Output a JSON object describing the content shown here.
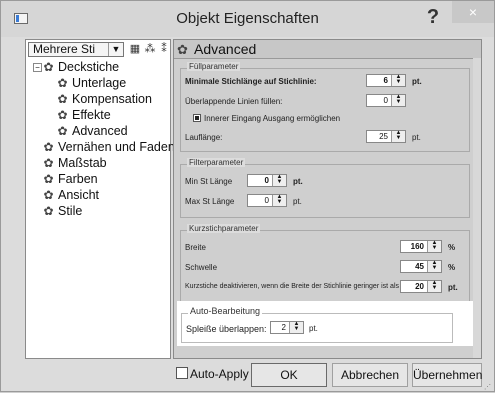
{
  "window": {
    "title": "Objekt Eigenschaften",
    "help": "?",
    "close": "×"
  },
  "left": {
    "combo": "Mehrere Sti",
    "tree": [
      {
        "label": "Deckstiche"
      },
      {
        "label": "Unterlage"
      },
      {
        "label": "Kompensation"
      },
      {
        "label": "Effekte"
      },
      {
        "label": "Advanced"
      },
      {
        "label": "Vernähen und Fadens"
      },
      {
        "label": "Maßstab"
      },
      {
        "label": "Farben"
      },
      {
        "label": "Ansicht"
      },
      {
        "label": "Stile"
      }
    ]
  },
  "right": {
    "header": "Advanced",
    "fuell": {
      "title": "Füllparameter",
      "min_label": "Minimale Stichlänge auf Stichlinie:",
      "min_value": "6",
      "unit_pt": "pt.",
      "ueber_label": "Überlappende Linien füllen:",
      "ueber_value": "0",
      "innerer_label": "Innerer Eingang Ausgang ermöglichen",
      "lauf_label": "Lauflänge:",
      "lauf_value": "25"
    },
    "filter": {
      "title": "Filterparameter",
      "min_label": "Min St Länge",
      "min_value": "0",
      "max_label": "Max St Länge",
      "max_value": "0"
    },
    "kurz": {
      "title": "Kurzstichparameter",
      "breite_label": "Breite",
      "breite_value": "160",
      "schwelle_label": "Schwelle",
      "schwelle_value": "45",
      "unit_pct": "%",
      "kdeak_label": "Kurzstiche deaktivieren, wenn die Breite der Stichlinie geringer ist als",
      "kdeak_value": "20"
    },
    "auto": {
      "title": "Auto-Bearbeitung",
      "spl_label": "Spleiße überlappen:",
      "spl_value": "2"
    }
  },
  "footer": {
    "autoapply": "Auto-Apply",
    "ok": "OK",
    "abbrechen": "Abbrechen",
    "uebernehmen": "Übernehmen"
  }
}
